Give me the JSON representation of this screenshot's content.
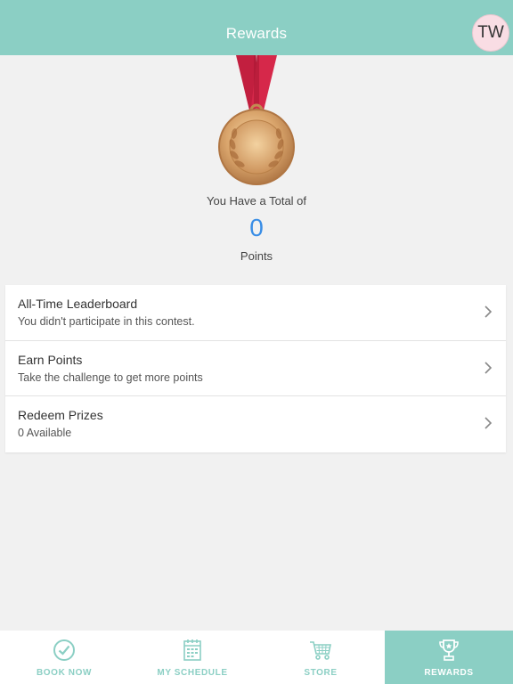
{
  "colors": {
    "accent": "#8bcfc4",
    "points_value": "#3a8ee6",
    "avatar_bg": "#f9dde4"
  },
  "header": {
    "title": "Rewards",
    "avatar_initials": "TW"
  },
  "summary": {
    "caption": "You Have a Total of",
    "points": "0",
    "unit": "Points"
  },
  "menu": {
    "items": [
      {
        "title": "All-Time Leaderboard",
        "subtitle": "You didn't participate in this contest.",
        "icon": "chevron-right-icon"
      },
      {
        "title": "Earn Points",
        "subtitle": "Take the challenge to get more points",
        "icon": "chevron-right-icon"
      },
      {
        "title": "Redeem Prizes",
        "subtitle": "0 Available",
        "icon": "chevron-right-icon"
      }
    ]
  },
  "tabs": [
    {
      "label": "BOOK NOW",
      "icon": "check-circle-icon",
      "active": false
    },
    {
      "label": "MY SCHEDULE",
      "icon": "calendar-icon",
      "active": false
    },
    {
      "label": "STORE",
      "icon": "cart-icon",
      "active": false
    },
    {
      "label": "REWARDS",
      "icon": "trophy-icon",
      "active": true
    }
  ]
}
